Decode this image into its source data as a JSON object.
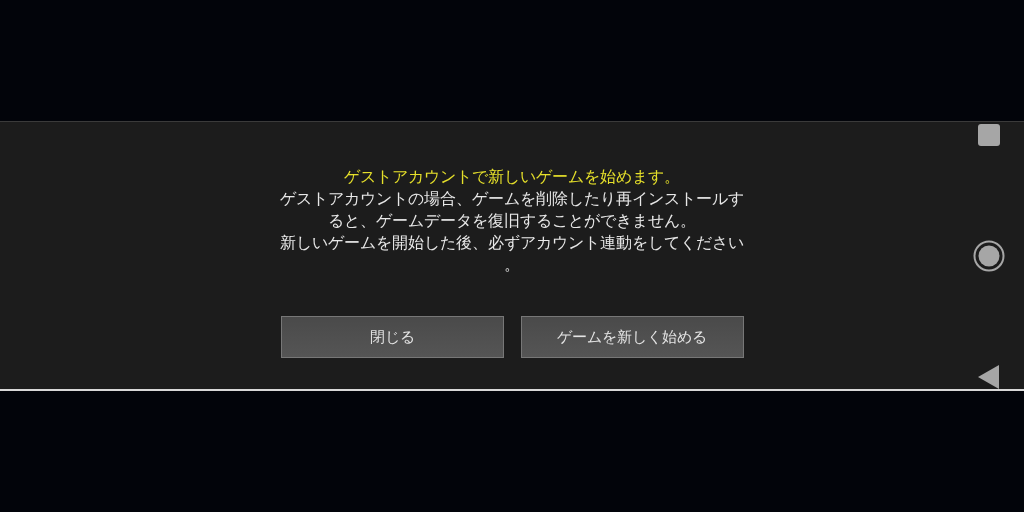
{
  "dialog": {
    "title": "ゲストアカウントで新しいゲームを始めます。",
    "message_lines": [
      "ゲストアカウントの場合、ゲームを削除したり再インストールす",
      "ると、ゲームデータを復旧することができません。",
      "新しいゲームを開始した後、必ずアカウント連動をしてください",
      "。"
    ],
    "buttons": [
      "閉じる",
      "ゲームを新しく始める"
    ]
  }
}
